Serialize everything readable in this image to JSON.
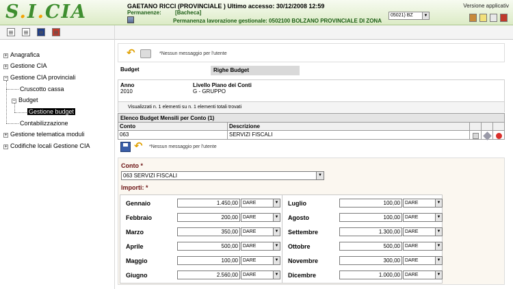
{
  "header": {
    "logo": "S.I.CIA",
    "user_line": "GAETANO RICCI (PROVINCIALE ) Ultimo accesso: 30/12/2008 12:59",
    "permanenze_label": "Permanenze:",
    "permanenze_value": "[Bacheca]",
    "permanenza_gestionale": "Permanenza lavorazione gestionale: 0502100 BOLZANO PROVINCIALE DI ZONA",
    "sede_select": "05021) BZ",
    "version": "Versione applicativ"
  },
  "sidebar": {
    "items": [
      {
        "label": "Anagrafica"
      },
      {
        "label": "Gestione CIA"
      },
      {
        "label": "Gestione CIA provinciali"
      },
      {
        "label": "Cruscotto cassa"
      },
      {
        "label": "Budget"
      },
      {
        "label": "Gestione budget"
      },
      {
        "label": "Contabilizzazione"
      },
      {
        "label": "Gestione telematica moduli"
      },
      {
        "label": "Codifiche locali Gestione CIA"
      }
    ]
  },
  "main": {
    "message1": "*Nessun messaggio per l'utente",
    "tab_budget": "Budget",
    "tab_righe": "Righe Budget",
    "anno_label": "Anno",
    "anno_value": "2010",
    "livello_label": "Livello Piano dei Conti",
    "livello_value": "G - GRUPPO",
    "info_bar": "Visualizzati n. 1 elementi su n. 1 elementi totali trovati",
    "list_title": "Elenco Budget Mensili per Conto (1)",
    "col_conto": "Conto",
    "col_descrizione": "Descrizione",
    "row_conto": "063",
    "row_descrizione": "SERVIZI FISCALI",
    "message2": "*Nessun messaggio per l'utente",
    "conto_label": "Conto *",
    "conto_value": "063 SERVIZI FISCALI",
    "importi_label": "Importi: *"
  },
  "months": [
    {
      "name": "Gennaio",
      "amount": "1.450,00",
      "type": "DARE"
    },
    {
      "name": "Febbraio",
      "amount": "200,00",
      "type": "DARE"
    },
    {
      "name": "Marzo",
      "amount": "350,00",
      "type": "DARE"
    },
    {
      "name": "Aprile",
      "amount": "500,00",
      "type": "DARE"
    },
    {
      "name": "Maggio",
      "amount": "100,00",
      "type": "DARE"
    },
    {
      "name": "Giugno",
      "amount": "2.560,00",
      "type": "DARE"
    },
    {
      "name": "Luglio",
      "amount": "100,00",
      "type": "DARE"
    },
    {
      "name": "Agosto",
      "amount": "100,00",
      "type": "DARE"
    },
    {
      "name": "Settembre",
      "amount": "1.300,00",
      "type": "DARE"
    },
    {
      "name": "Ottobre",
      "amount": "500,00",
      "type": "DARE"
    },
    {
      "name": "Novembre",
      "amount": "300,00",
      "type": "DARE"
    },
    {
      "name": "Dicembre",
      "amount": "1.000,00",
      "type": "DARE"
    }
  ],
  "icons": {
    "undo": "undo-icon",
    "print": "print-icon",
    "save": "save-icon",
    "edit": "edit-icon",
    "tools": "tools-icon",
    "delete": "delete-icon"
  }
}
